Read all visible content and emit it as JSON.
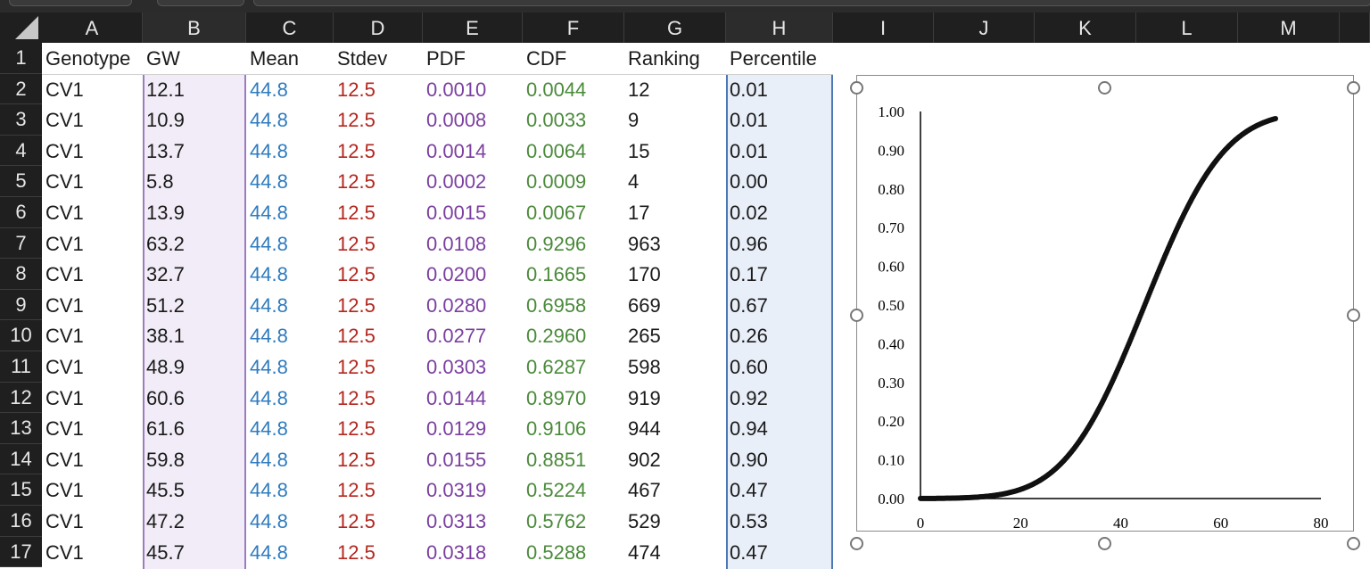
{
  "columns": [
    "A",
    "B",
    "C",
    "D",
    "E",
    "F",
    "G",
    "H",
    "I",
    "J",
    "K",
    "L",
    "M"
  ],
  "rows": [
    "1",
    "2",
    "3",
    "4",
    "5",
    "6",
    "7",
    "8",
    "9",
    "10",
    "11",
    "12",
    "13",
    "14",
    "15",
    "16",
    "17"
  ],
  "headers": [
    "Genotype",
    "GW",
    "Mean",
    "Stdev",
    "PDF",
    "CDF",
    "Ranking",
    "Percentile"
  ],
  "table": [
    [
      "CV1",
      "12.1",
      "44.8",
      "12.5",
      "0.0010",
      "0.0044",
      "12",
      "0.01"
    ],
    [
      "CV1",
      "10.9",
      "44.8",
      "12.5",
      "0.0008",
      "0.0033",
      "9",
      "0.01"
    ],
    [
      "CV1",
      "13.7",
      "44.8",
      "12.5",
      "0.0014",
      "0.0064",
      "15",
      "0.01"
    ],
    [
      "CV1",
      "5.8",
      "44.8",
      "12.5",
      "0.0002",
      "0.0009",
      "4",
      "0.00"
    ],
    [
      "CV1",
      "13.9",
      "44.8",
      "12.5",
      "0.0015",
      "0.0067",
      "17",
      "0.02"
    ],
    [
      "CV1",
      "63.2",
      "44.8",
      "12.5",
      "0.0108",
      "0.9296",
      "963",
      "0.96"
    ],
    [
      "CV1",
      "32.7",
      "44.8",
      "12.5",
      "0.0200",
      "0.1665",
      "170",
      "0.17"
    ],
    [
      "CV1",
      "51.2",
      "44.8",
      "12.5",
      "0.0280",
      "0.6958",
      "669",
      "0.67"
    ],
    [
      "CV1",
      "38.1",
      "44.8",
      "12.5",
      "0.0277",
      "0.2960",
      "265",
      "0.26"
    ],
    [
      "CV1",
      "48.9",
      "44.8",
      "12.5",
      "0.0303",
      "0.6287",
      "598",
      "0.60"
    ],
    [
      "CV1",
      "60.6",
      "44.8",
      "12.5",
      "0.0144",
      "0.8970",
      "919",
      "0.92"
    ],
    [
      "CV1",
      "61.6",
      "44.8",
      "12.5",
      "0.0129",
      "0.9106",
      "944",
      "0.94"
    ],
    [
      "CV1",
      "59.8",
      "44.8",
      "12.5",
      "0.0155",
      "0.8851",
      "902",
      "0.90"
    ],
    [
      "CV1",
      "45.5",
      "44.8",
      "12.5",
      "0.0319",
      "0.5224",
      "467",
      "0.47"
    ],
    [
      "CV1",
      "47.2",
      "44.8",
      "12.5",
      "0.0313",
      "0.5762",
      "529",
      "0.53"
    ],
    [
      "CV1",
      "45.7",
      "44.8",
      "12.5",
      "0.0318",
      "0.5288",
      "474",
      "0.47"
    ]
  ],
  "colors": {
    "mean": "#2e7bbf",
    "stdev": "#b3261e",
    "pdf": "#7b3fa0",
    "cdf": "#4a8a3a"
  },
  "chart_data": {
    "type": "scatter",
    "series": [
      {
        "mean": 44.8,
        "stdev": 12.5,
        "x_min": 0,
        "x_max": 71
      }
    ],
    "x_ticks": [
      "0",
      "20",
      "40",
      "60",
      "80"
    ],
    "y_ticks": [
      "0.00",
      "0.10",
      "0.20",
      "0.30",
      "0.40",
      "0.50",
      "0.60",
      "0.70",
      "0.80",
      "0.90",
      "1.00"
    ],
    "xlim": [
      0,
      80
    ],
    "ylim": [
      0,
      1
    ],
    "grid": false
  }
}
